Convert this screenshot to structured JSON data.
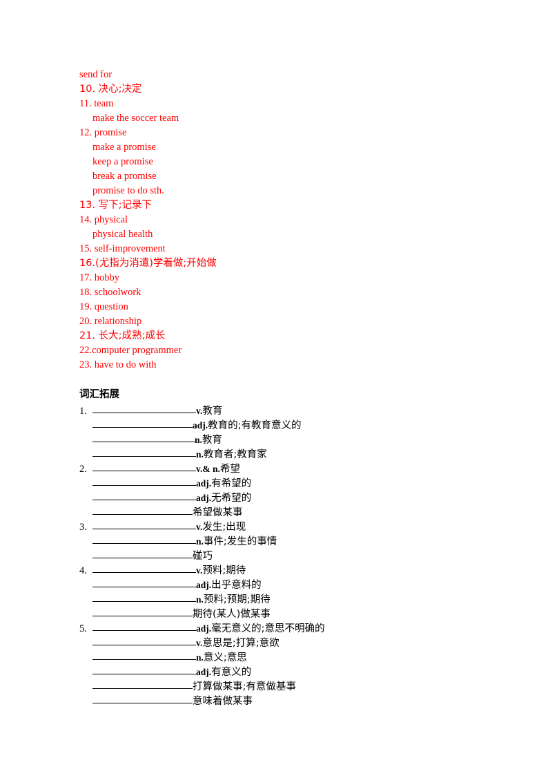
{
  "document": {
    "colors": {
      "vocab_list_text": "#ff0000",
      "body_text": "#000000",
      "page_background": "#ffffff"
    },
    "vocab_list": {
      "items": [
        {
          "indent": "none",
          "text": "send for"
        },
        {
          "indent": "none",
          "text": "10. 决心;决定"
        },
        {
          "indent": "none",
          "text": "11. team"
        },
        {
          "indent": "sub",
          "text": "make the soccer team"
        },
        {
          "indent": "none",
          "text": "12. promise"
        },
        {
          "indent": "sub",
          "text": "make a promise"
        },
        {
          "indent": "sub",
          "text": "keep a promise"
        },
        {
          "indent": "sub",
          "text": "break a promise"
        },
        {
          "indent": "sub",
          "text": "promise to do sth."
        },
        {
          "indent": "none",
          "text": "13. 写下;记录下"
        },
        {
          "indent": "none",
          "text": "14. physical"
        },
        {
          "indent": "sub",
          "text": "physical health"
        },
        {
          "indent": "none",
          "text": "15. self-improvement"
        },
        {
          "indent": "none",
          "text": "16.(尤指为消遣)学着做;开始做"
        },
        {
          "indent": "none",
          "text": "17. hobby"
        },
        {
          "indent": "none",
          "text": "18. schoolwork"
        },
        {
          "indent": "none",
          "text": "19. question"
        },
        {
          "indent": "none",
          "text": "20. relationship"
        },
        {
          "indent": "none",
          "text": "21. 长大;成熟;成长"
        },
        {
          "indent": "none",
          "text": "22.computer programmer"
        },
        {
          "indent": "none",
          "text": "23. have to do with"
        }
      ]
    },
    "section_heading": "词汇拓展",
    "word_formation": {
      "entries": [
        {
          "number": "1.",
          "rows": [
            {
              "blank_width": 150,
              "pos": "v.",
              "meaning": "教育"
            },
            {
              "blank_width": 145,
              "pos": "adj.",
              "meaning": "教育的;有教育意义的"
            },
            {
              "blank_width": 148,
              "pos": "n.",
              "meaning": "教育"
            },
            {
              "blank_width": 150,
              "pos": "n.",
              "meaning": "教育者;教育家"
            }
          ]
        },
        {
          "number": "2.",
          "rows": [
            {
              "blank_width": 150,
              "pos": "v.& n.",
              "meaning": "希望"
            },
            {
              "blank_width": 150,
              "pos": "adj.",
              "meaning": "有希望的"
            },
            {
              "blank_width": 150,
              "pos": "adj.",
              "meaning": "无希望的"
            },
            {
              "blank_width": 145,
              "pos": "",
              "meaning": "希望做某事"
            }
          ]
        },
        {
          "number": "3.",
          "rows": [
            {
              "blank_width": 150,
              "pos": "v.",
              "meaning": "发生;出现"
            },
            {
              "blank_width": 150,
              "pos": "n.",
              "meaning": "事件;发生的事情"
            },
            {
              "blank_width": 145,
              "pos": "",
              "meaning": "碰巧"
            }
          ]
        },
        {
          "number": "4.",
          "rows": [
            {
              "blank_width": 150,
              "pos": "v.",
              "meaning": "预料;期待"
            },
            {
              "blank_width": 150,
              "pos": "adj.",
              "meaning": "出乎意料的"
            },
            {
              "blank_width": 150,
              "pos": "n.",
              "meaning": "预料;预期;期待"
            },
            {
              "blank_width": 145,
              "pos": "",
              "meaning": "期待(某人)做某事"
            }
          ]
        },
        {
          "number": "5.",
          "rows": [
            {
              "blank_width": 150,
              "pos": "adj.",
              "meaning": "毫无意义的;意思不明确的"
            },
            {
              "blank_width": 150,
              "pos": "v.",
              "meaning": "意思是;打算;意欲"
            },
            {
              "blank_width": 150,
              "pos": "n.",
              "meaning": "意义;意思"
            },
            {
              "blank_width": 150,
              "pos": "adj.",
              "meaning": "有意义的"
            },
            {
              "blank_width": 145,
              "pos": "",
              "meaning": "打算做某事;有意做基事"
            },
            {
              "blank_width": 145,
              "pos": "",
              "meaning": "意味着做某事"
            }
          ]
        }
      ]
    }
  }
}
